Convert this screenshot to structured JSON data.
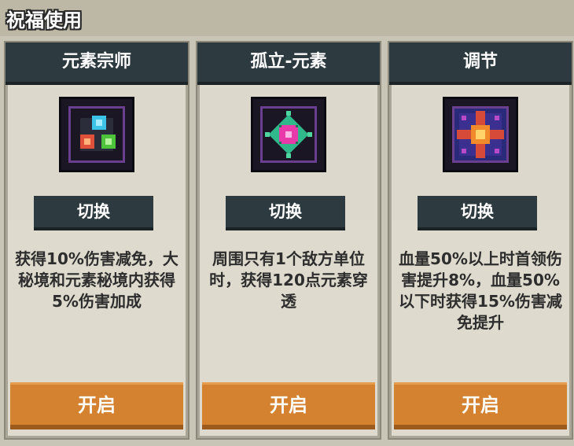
{
  "panel": {
    "title": "祝福使用"
  },
  "cards": [
    {
      "name": "元素宗师",
      "icon": "elemental-master-icon",
      "switch_label": "切换",
      "description": "获得10%伤害减免，大秘境和元素秘境内获得5%伤害加成",
      "open_label": "开启"
    },
    {
      "name": "孤立-元素",
      "icon": "isolation-element-icon",
      "switch_label": "切换",
      "description": "周围只有1个敌方单位时，获得120点元素穿透",
      "open_label": "开启"
    },
    {
      "name": "调节",
      "icon": "regulation-icon",
      "switch_label": "切换",
      "description": "血量50%以上时首领伤害提升8%，血量50%以下时获得15%伤害减免提升",
      "open_label": "开启"
    }
  ],
  "colors": {
    "header_bg": "#2d3a40",
    "button_orange": "#d4822f",
    "card_bg": "#dedacd",
    "icon_border": "#6a3f8f"
  }
}
